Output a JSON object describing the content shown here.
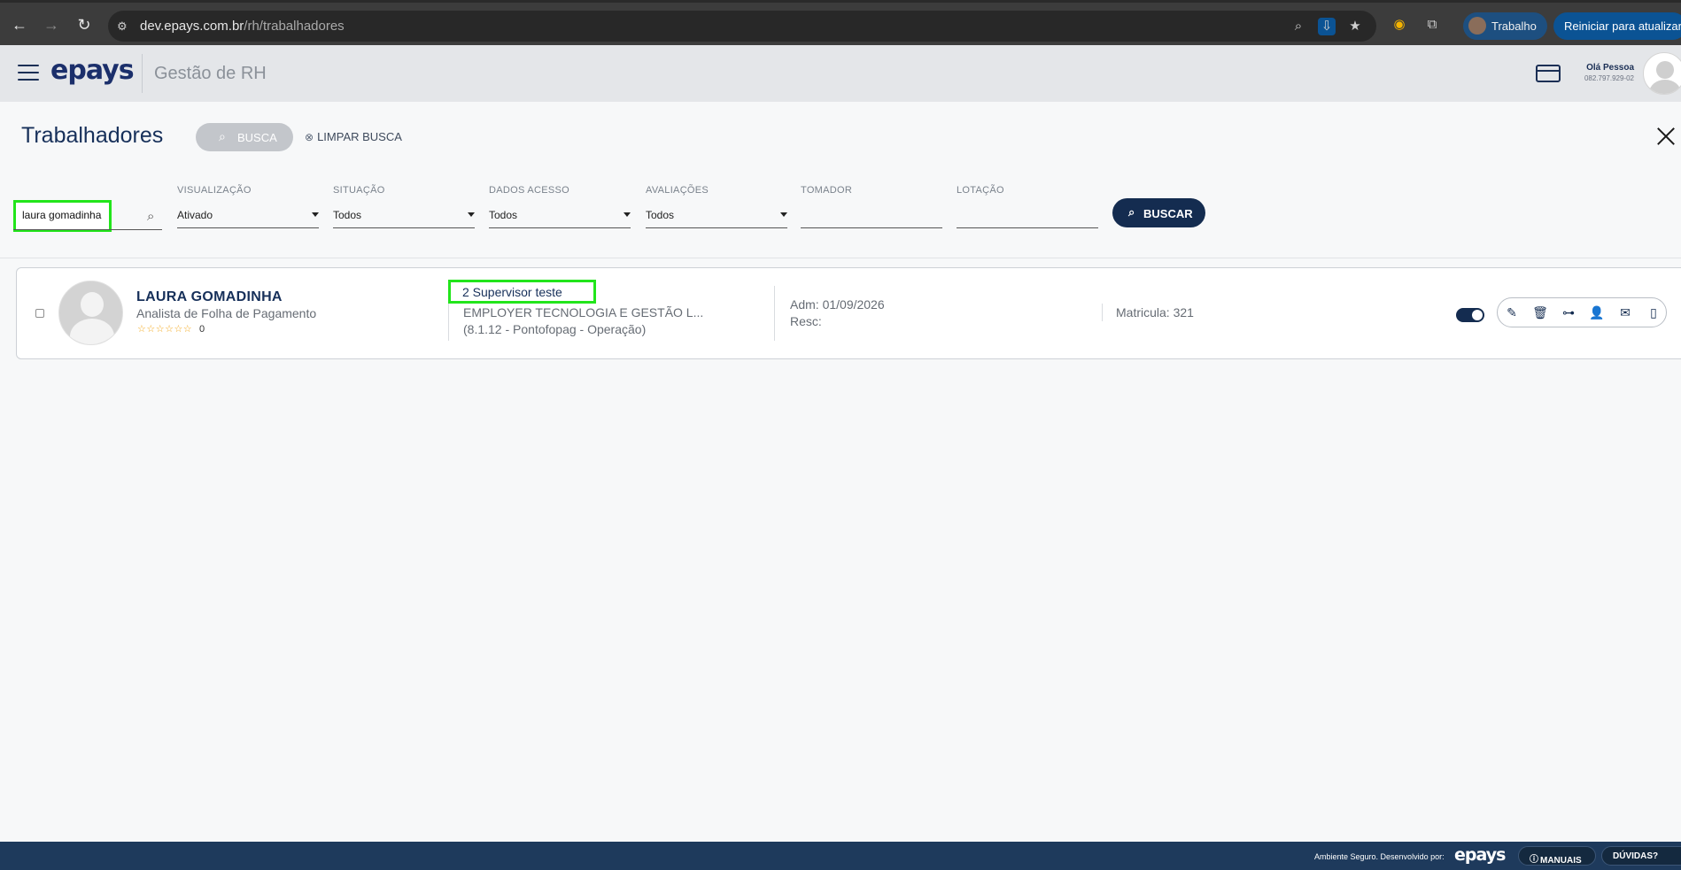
{
  "browser": {
    "url_host": "dev.epays.com.br",
    "url_path": "/rh/trabalhadores",
    "profile_label": "Trabalho",
    "update_label": "Reiniciar para atualizar"
  },
  "header": {
    "logo": "epays",
    "module": "Gestão de RH",
    "user_name": "Olá Pessoa",
    "user_doc": "082.797.929-02"
  },
  "page": {
    "title": "Trabalhadores",
    "busca_label": "BUSCA",
    "limpar_label": "LIMPAR BUSCA"
  },
  "filters": {
    "search_value": "laura gomadinha",
    "visualizacao": {
      "label": "VISUALIZAÇÃO",
      "value": "Ativado"
    },
    "situacao": {
      "label": "SITUAÇÃO",
      "value": "Todos"
    },
    "dados_acesso": {
      "label": "DADOS ACESSO",
      "value": "Todos"
    },
    "avaliacoes": {
      "label": "AVALIAÇÕES",
      "value": "Todos"
    },
    "tomador": {
      "label": "TOMADOR",
      "value": ""
    },
    "lotacao": {
      "label": "LOTAÇÃO",
      "value": ""
    },
    "buscar_label": "BUSCAR"
  },
  "worker": {
    "name": "LAURA GOMADINHA",
    "role": "Analista de Folha de Pagamento",
    "stars": "☆☆☆☆☆☆",
    "rating": "0",
    "supervisor": "2 Supervisor teste",
    "company": "EMPLOYER TECNOLOGIA E GESTÃO L...",
    "lotacao": "(8.1.12 - Pontofopag - Operação)",
    "adm": "Adm: 01/09/2026",
    "resc": "Resc:",
    "matricula": "Matricula: 321",
    "active": true
  },
  "footer": {
    "developed_by": "Ambiente Seguro. Desenvolvido por:",
    "logo": "epays",
    "manuais": "MANUAIS",
    "duvidas": "DÚVIDAS?"
  },
  "colors": {
    "primary": "#142c50",
    "highlight": "#22e51b",
    "star": "#f3a81b"
  }
}
